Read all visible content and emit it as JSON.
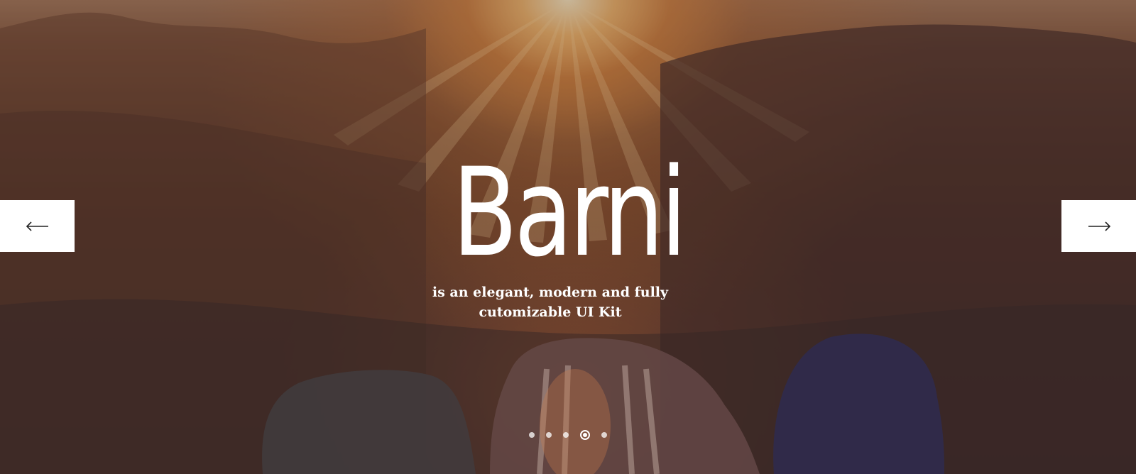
{
  "hero": {
    "title": "Barni",
    "subtitle": "is an elegant, modern and fully cutomizable UI Kit"
  },
  "navigation": {
    "prev_icon": "arrow-left-icon",
    "next_icon": "arrow-right-icon"
  },
  "carousel": {
    "slide_count": 5,
    "active_slide": 4
  },
  "colors": {
    "text": "#ffffff",
    "button_bg": "#ffffff",
    "arrow": "#222222"
  }
}
